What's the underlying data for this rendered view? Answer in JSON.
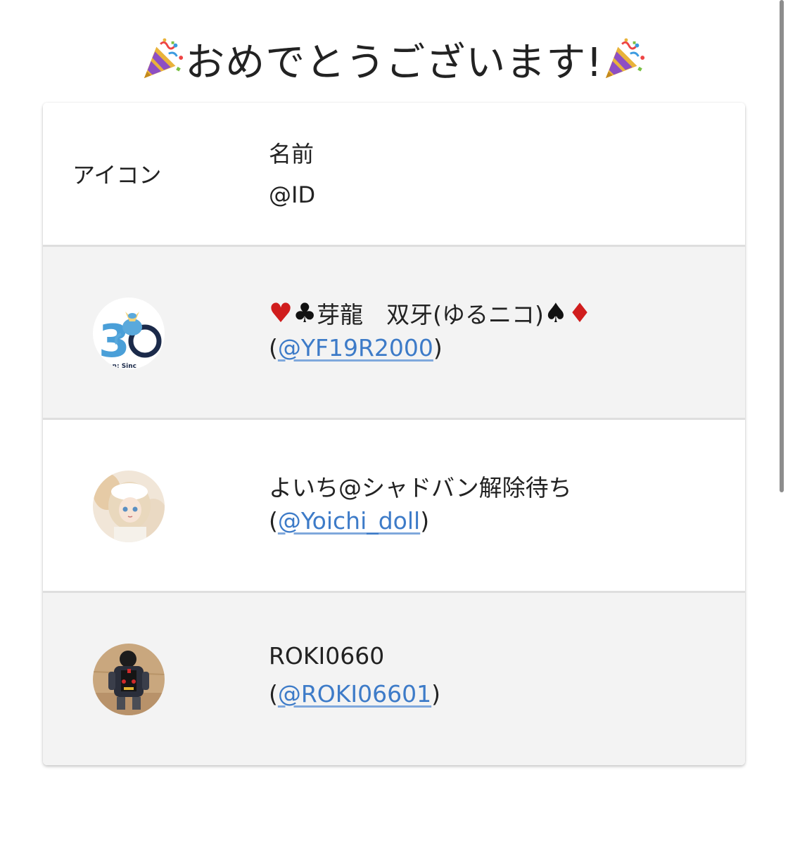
{
  "title": {
    "text": "おめでとうございます!",
    "left_icon": "party-popper-icon",
    "right_icon": "party-popper-icon"
  },
  "table": {
    "header": {
      "icon_label": "アイコン",
      "name_label": "名前",
      "id_label": "@ID"
    },
    "rows": [
      {
        "avatar": "vaporeon-30th-avatar",
        "name_prefix_suits": [
          "♥",
          "♣"
        ],
        "name_text": "芽龍　双牙(ゆるニコ)",
        "name_suffix_suits": [
          "♠",
          "♦"
        ],
        "handle_open": "(",
        "handle": "@YF19R2000",
        "handle_close": ")"
      },
      {
        "avatar": "doll-avatar",
        "name_text": "よいち@シャドバン解除待ち",
        "handle_open": "(",
        "handle": "@Yoichi_doll",
        "handle_close": ")"
      },
      {
        "avatar": "child-photo-avatar",
        "name_text": "ROKI0660",
        "handle_open": "(",
        "handle": "@ROKI06601",
        "handle_close": ")"
      }
    ]
  },
  "colors": {
    "link": "#3d7bc8",
    "row_alt": "#f3f3f3",
    "heart_diamond": "#d01d1d"
  }
}
